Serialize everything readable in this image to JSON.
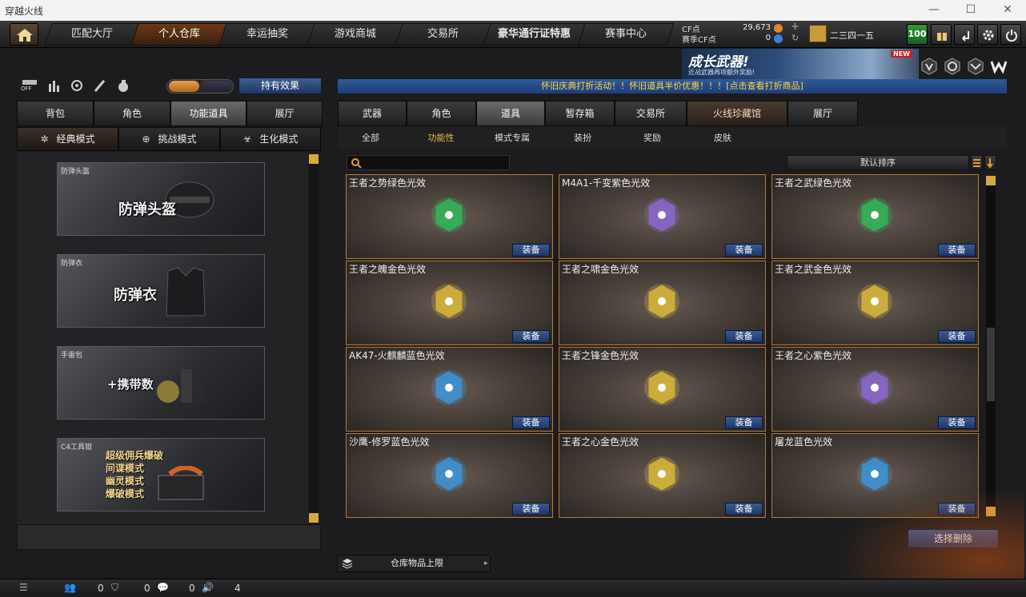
{
  "window": {
    "title": "穿越火线"
  },
  "topnav": {
    "tabs": [
      {
        "label": "匹配大厅"
      },
      {
        "label": "个人仓库"
      },
      {
        "label": "幸运抽奖"
      },
      {
        "label": "游戏商城"
      },
      {
        "label": "交易所"
      },
      {
        "label": "豪华通行证特惠"
      },
      {
        "label": "赛事中心"
      }
    ],
    "active_tab": "个人仓库",
    "cf_label": "CF点",
    "cf_value": "29,673",
    "match_cf_label": "赛季CF点",
    "match_cf_value": "0",
    "player_name": "二三四一五",
    "level": "100"
  },
  "banner": {
    "headline": "成长武器!",
    "subline": "近战武器再项额外奖励!",
    "badge": "NEW"
  },
  "left": {
    "toggle_off_label": "OFF",
    "effect_button": "持有效果",
    "tabs": [
      {
        "label": "背包"
      },
      {
        "label": "角色"
      },
      {
        "label": "功能道具"
      },
      {
        "label": "展厅"
      }
    ],
    "mode_tabs": [
      {
        "label": "经典模式"
      },
      {
        "label": "挑战模式"
      },
      {
        "label": "生化模式"
      }
    ],
    "cards": [
      {
        "caption": "防弹头盔",
        "title": "防弹头盔"
      },
      {
        "caption": "防弹衣",
        "title": "防弹衣"
      },
      {
        "caption": "手雷包",
        "title": "+携带数"
      },
      {
        "caption": "C4工具钳",
        "lines": [
          "超级佣兵爆破",
          "间谍模式",
          "幽灵模式",
          "爆破模式"
        ]
      }
    ]
  },
  "right": {
    "notice": "怀旧庆典打折活动！！怀旧道具半价优惠！！！[点击查看打折商品]",
    "tabs": [
      {
        "label": "武器"
      },
      {
        "label": "角色"
      },
      {
        "label": "道具"
      },
      {
        "label": "暂存箱"
      },
      {
        "label": "交易所"
      },
      {
        "label": "火线珍藏馆"
      },
      {
        "label": "展厅"
      }
    ],
    "subtabs": [
      {
        "label": "全部"
      },
      {
        "label": "功能性"
      },
      {
        "label": "模式专属"
      },
      {
        "label": "装扮"
      },
      {
        "label": "奖励"
      },
      {
        "label": "皮肤"
      }
    ],
    "sort_label": "默认排序",
    "equip_label": "装备",
    "items": [
      {
        "name": "王者之势绿色光效",
        "color": "#2fbf5c"
      },
      {
        "name": "M4A1-千变紫色光效",
        "color": "#8f6ad8"
      },
      {
        "name": "王者之武绿色光效",
        "color": "#2fbf5c"
      },
      {
        "name": "王者之魄金色光效",
        "color": "#e6c13a"
      },
      {
        "name": "王者之啸金色光效",
        "color": "#e6c13a"
      },
      {
        "name": "王者之武金色光效",
        "color": "#e6c13a"
      },
      {
        "name": "AK47-火麒麟蓝色光效",
        "color": "#3a9be6"
      },
      {
        "name": "王者之锋金色光效",
        "color": "#e6c13a"
      },
      {
        "name": "王者之心紫色光效",
        "color": "#8f6ad8"
      },
      {
        "name": "沙鹰-修罗蓝色光效",
        "color": "#3a9be6"
      },
      {
        "name": "王者之心金色光效",
        "color": "#e6c13a"
      },
      {
        "name": "屠龙蓝色光效",
        "color": "#3a9be6"
      }
    ],
    "delete_button": "选择删除",
    "storage_limit": "仓库物品上限"
  },
  "statusbar": {
    "friends": "0",
    "clan": "0",
    "chat": "0",
    "volume": "4"
  }
}
